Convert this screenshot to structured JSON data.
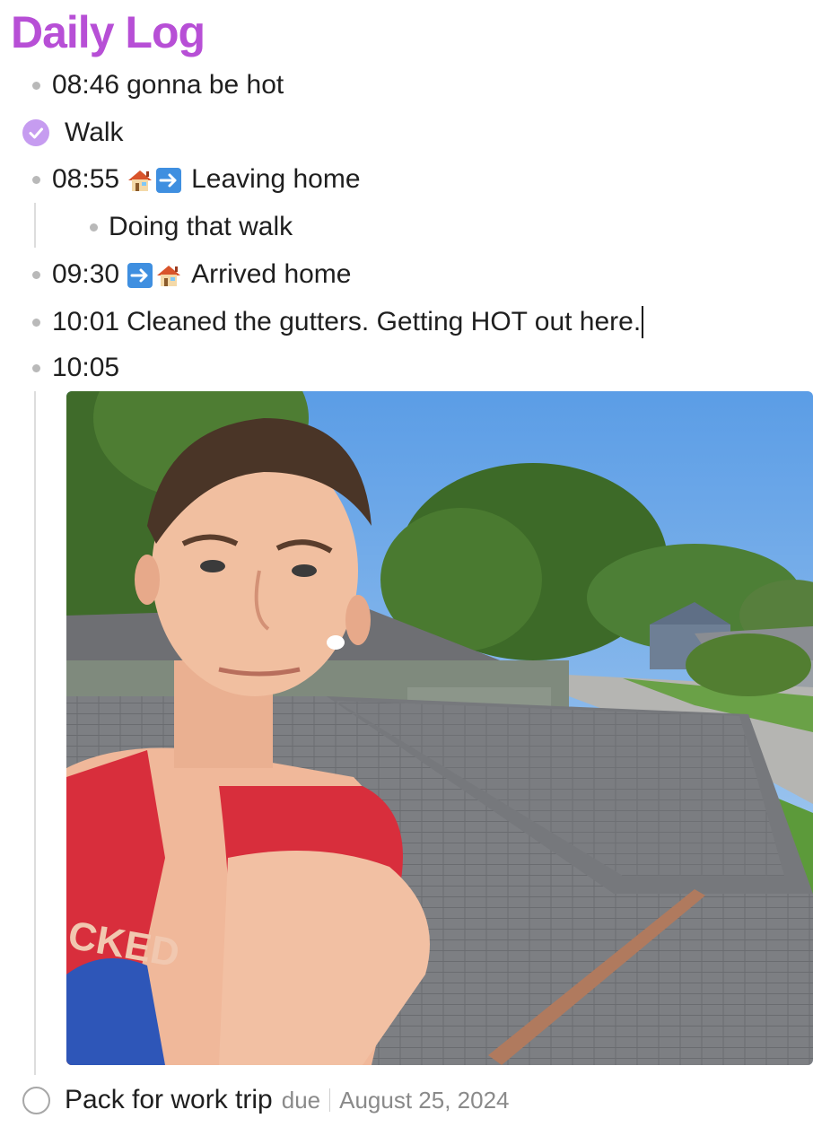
{
  "page": {
    "title": "Daily Log",
    "accent_color": "#b74fd6"
  },
  "entries": [
    {
      "time": "08:46",
      "text": "gonna be hot"
    },
    {
      "task": "Walk",
      "status": "completed"
    },
    {
      "time": "08:55",
      "icons": [
        "house-icon",
        "right-arrow-icon"
      ],
      "text": "Leaving home"
    },
    {
      "text": "Doing that walk"
    },
    {
      "time": "09:30",
      "icons": [
        "right-arrow-icon",
        "house-icon"
      ],
      "text": "Arrived home"
    },
    {
      "time": "10:01",
      "text": "Cleaned the gutters. Getting HOT out here."
    },
    {
      "time": "10:05"
    }
  ],
  "photo": {
    "subject": "rooftop-selfie-photo",
    "shirt_text": "CKED"
  },
  "todo": {
    "label": "Pack for work trip",
    "due_label": "due",
    "due_date": "August 25, 2024"
  }
}
